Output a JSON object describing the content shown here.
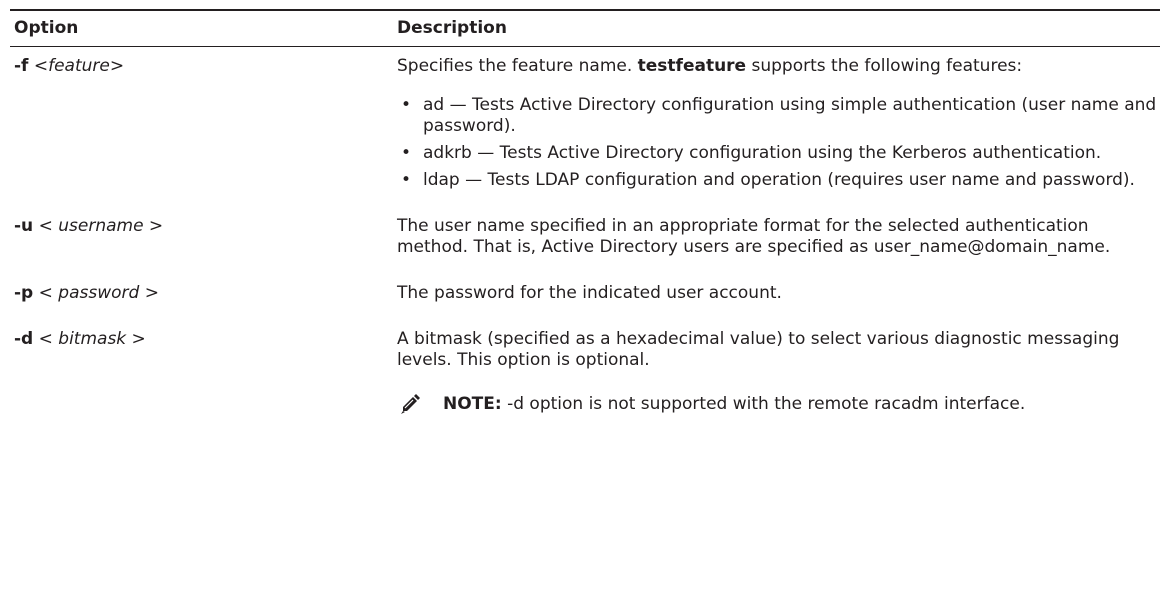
{
  "table": {
    "header": {
      "option": "Option",
      "description": "Description"
    },
    "rows": [
      {
        "flag": "-f",
        "arg_open": " <",
        "arg": "feature",
        "arg_close": ">",
        "description": {
          "intro_before": "Specifies the feature name. ",
          "intro_bold": "testfeature",
          "intro_after": " supports the following features:",
          "bullets": [
            "ad — Tests Active Directory configuration using simple authentication (user name and password).",
            "adkrb — Tests Active Directory configuration using the Kerberos authentication.",
            "ldap — Tests LDAP configuration and operation (requires user name and password)."
          ]
        }
      },
      {
        "flag": "-u",
        "arg_open": " < ",
        "arg": "username",
        "arg_close": " >",
        "description": {
          "text": "The user name specified in an appropriate format for the selected authentication method. That is, Active Directory users are specified as user_name@domain_name."
        }
      },
      {
        "flag": "-p",
        "arg_open": " < ",
        "arg": "password",
        "arg_close": " >",
        "description": {
          "text": "The password for the indicated user account."
        }
      },
      {
        "flag": "-d",
        "arg_open": " < ",
        "arg": "bitmask",
        "arg_close": " >",
        "description": {
          "text": "A bitmask (specified as a hexadecimal value) to select various diagnostic messaging levels. This option is optional.",
          "note_label": "NOTE:",
          "note_text": " -d option is not supported with the remote racadm interface."
        }
      }
    ],
    "bullet_glyph": "•",
    "note_icon": "pencil-note-icon"
  }
}
